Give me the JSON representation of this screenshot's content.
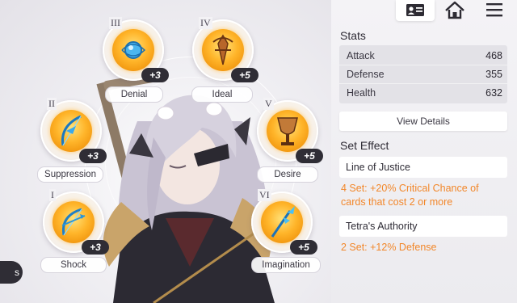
{
  "slots": [
    {
      "numeral": "I",
      "name": "Shock",
      "level": "+3",
      "icon": "bow-icon"
    },
    {
      "numeral": "II",
      "name": "Suppression",
      "level": "+3",
      "icon": "bow-icon"
    },
    {
      "numeral": "III",
      "name": "Denial",
      "level": "+3",
      "icon": "orb-icon"
    },
    {
      "numeral": "IV",
      "name": "Ideal",
      "level": "+5",
      "icon": "emblem-icon"
    },
    {
      "numeral": "V",
      "name": "Desire",
      "level": "+5",
      "icon": "chalice-icon"
    },
    {
      "numeral": "VI",
      "name": "Imagination",
      "level": "+5",
      "icon": "staff-icon"
    }
  ],
  "side_tab": {
    "label": "s"
  },
  "topbar": {
    "profile_icon": "profile-card-icon",
    "home_icon": "home-icon",
    "menu_icon": "menu-icon"
  },
  "stats": {
    "title": "Stats",
    "rows": [
      {
        "label": "Attack",
        "value": "468"
      },
      {
        "label": "Defense",
        "value": "355"
      },
      {
        "label": "Health",
        "value": "632"
      }
    ],
    "details_button": "View Details"
  },
  "set_effect": {
    "title": "Set Effect",
    "sets": [
      {
        "name": "Line of Justice",
        "desc_line1": "4 Set: +20% Critical Chance of",
        "desc_line2": "cards that cost 2 or more"
      },
      {
        "name": "Tetra's Authority",
        "desc_line1": "2 Set: +12% Defense"
      }
    ]
  },
  "colors": {
    "accent": "#f2872a",
    "badge": "#2f2d35",
    "orb": "#ffb52a"
  }
}
